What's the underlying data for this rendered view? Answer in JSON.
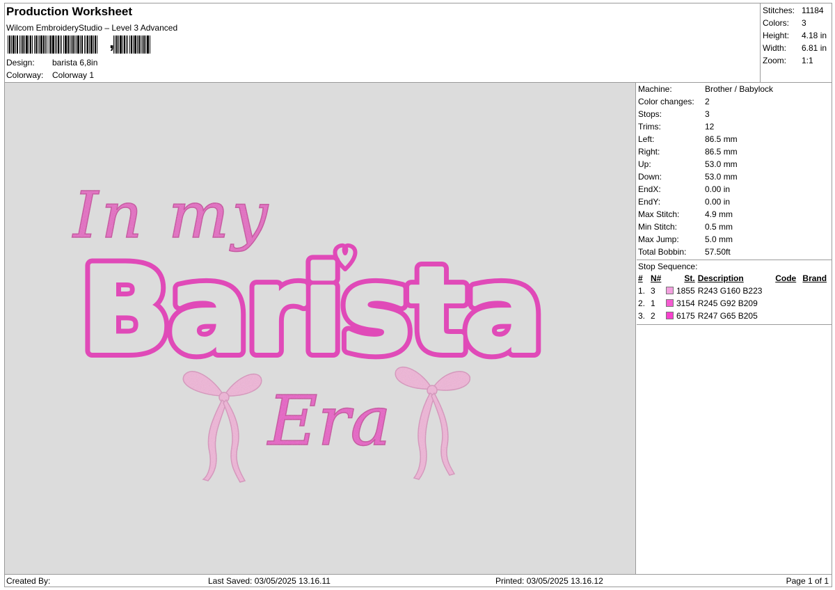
{
  "header": {
    "title": "Production Worksheet",
    "software": "Wilcom EmbroideryStudio – Level 3 Advanced",
    "design_label": "Design:",
    "design_value": "barista 6,8in",
    "colorway_label": "Colorway:",
    "colorway_value": "Colorway 1"
  },
  "summary": {
    "stitches_label": "Stitches:",
    "stitches_value": "11184",
    "colors_label": "Colors:",
    "colors_value": "3",
    "height_label": "Height:",
    "height_value": "4.18 in",
    "width_label": "Width:",
    "width_value": "6.81 in",
    "zoom_label": "Zoom:",
    "zoom_value": "1:1"
  },
  "details": [
    {
      "label": "Machine:",
      "value": "Brother / Babylock"
    },
    {
      "label": "Color changes:",
      "value": "2"
    },
    {
      "label": "Stops:",
      "value": "3"
    },
    {
      "label": "Trims:",
      "value": "12"
    },
    {
      "label": "Left:",
      "value": "86.5 mm"
    },
    {
      "label": "Right:",
      "value": "86.5 mm"
    },
    {
      "label": "Up:",
      "value": "53.0 mm"
    },
    {
      "label": "Down:",
      "value": "53.0 mm"
    },
    {
      "label": "EndX:",
      "value": "0.00 in"
    },
    {
      "label": "EndY:",
      "value": "0.00 in"
    },
    {
      "label": "Max Stitch:",
      "value": "4.9 mm"
    },
    {
      "label": "Min Stitch:",
      "value": "0.5 mm"
    },
    {
      "label": "Max Jump:",
      "value": "5.0 mm"
    },
    {
      "label": "Total Bobbin:",
      "value": "57.50ft"
    }
  ],
  "stop_sequence": {
    "title": "Stop Sequence:",
    "headers": {
      "num": "#",
      "n": "N#",
      "st": "St.",
      "description": "Description",
      "code": "Code",
      "brand": "Brand"
    },
    "rows": [
      {
        "num": "1.",
        "n": "3",
        "color": "#f3a0df",
        "st": "1855",
        "description": "R243 G160 B223",
        "code": "",
        "brand": ""
      },
      {
        "num": "2.",
        "n": "1",
        "color": "#f55cd1",
        "st": "3154",
        "description": "R245 G92 B209",
        "code": "",
        "brand": ""
      },
      {
        "num": "3.",
        "n": "2",
        "color": "#f741cd",
        "st": "6175",
        "description": "R247 G65 B205",
        "code": "",
        "brand": ""
      }
    ]
  },
  "design_art": {
    "line1": "In my",
    "line2": "Barista",
    "line3": "Era",
    "thread_light": "#f3a0df",
    "thread_mid": "#f55cd1",
    "thread_dark": "#e04ab8",
    "bow_color": "#f0b0d6"
  },
  "footer": {
    "created_by": "Created By:",
    "last_saved": "Last Saved: 03/05/2025 13.16.11",
    "printed": "Printed: 03/05/2025 13.16.12",
    "page": "Page 1 of 1"
  }
}
